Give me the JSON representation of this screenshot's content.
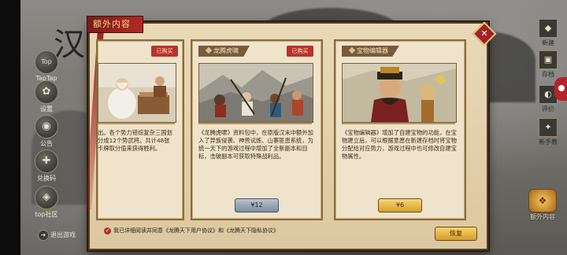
{
  "game": {
    "bg_char": "汉",
    "leave_game": "退出游戏"
  },
  "left_menu": [
    {
      "icon": "top-icon",
      "glyph": "Top",
      "label": "TapTap"
    },
    {
      "icon": "settings-icon",
      "glyph": "✿",
      "label": "设置"
    },
    {
      "icon": "announcement-icon",
      "glyph": "◉",
      "label": "公告"
    },
    {
      "icon": "redeem-icon",
      "glyph": "✚",
      "label": "兑换码"
    },
    {
      "icon": "community-icon",
      "glyph": "◈",
      "label": "top社区"
    }
  ],
  "right_menu": [
    {
      "icon": "new-game-icon",
      "glyph": "◆",
      "label": "新建"
    },
    {
      "icon": "archive-icon",
      "glyph": "▣",
      "label": "存档"
    },
    {
      "icon": "review-icon",
      "glyph": "◐",
      "label": "评价"
    },
    {
      "icon": "tutorial-icon",
      "glyph": "✦",
      "label": "新手教"
    }
  ],
  "extra_content_button": {
    "label": "额外内容",
    "glyph": "❖"
  },
  "panel": {
    "title": "额外内容",
    "close_glyph": "✕",
    "agree_prefix": "我已详细阅读并同意",
    "agree_link1": "《龙腾天下用户协议》",
    "agree_and": "和",
    "agree_link2": "《龙腾天下隐私协议》",
    "restore_label": "恢复",
    "check_glyph": "✓"
  },
  "cards": [
    {
      "title": "",
      "ribbon": "已购买",
      "desc": "出。各个势力错综复杂三国划分成12个势武将。共计48张卡牌取分值来获得胜利。",
      "price": ""
    },
    {
      "title": "龙腾虎啸",
      "ribbon": "已购买",
      "desc": "《龙腾虎啸》资料包中，在原版汉末中额外加入了异族侵袭、神兽试炼、山寨匪患系统，为统一天下的游戏过程中增加了全新副本和目标，击破副本可获取特殊战利品。",
      "price": "¥12"
    },
    {
      "title": "宝物编辑器",
      "ribbon": "",
      "desc": "《宝物编辑器》增加了自建宝物的功能，在宝物建立后，可以根据意愿在新建存档时将宝物分配给对应势力，游戏过程中也可修改自建宝物属性。",
      "price": "¥6"
    }
  ],
  "colors": {
    "accent_red": "#b4242b",
    "gold": "#f2c14e",
    "paper": "#e9d9b7"
  }
}
